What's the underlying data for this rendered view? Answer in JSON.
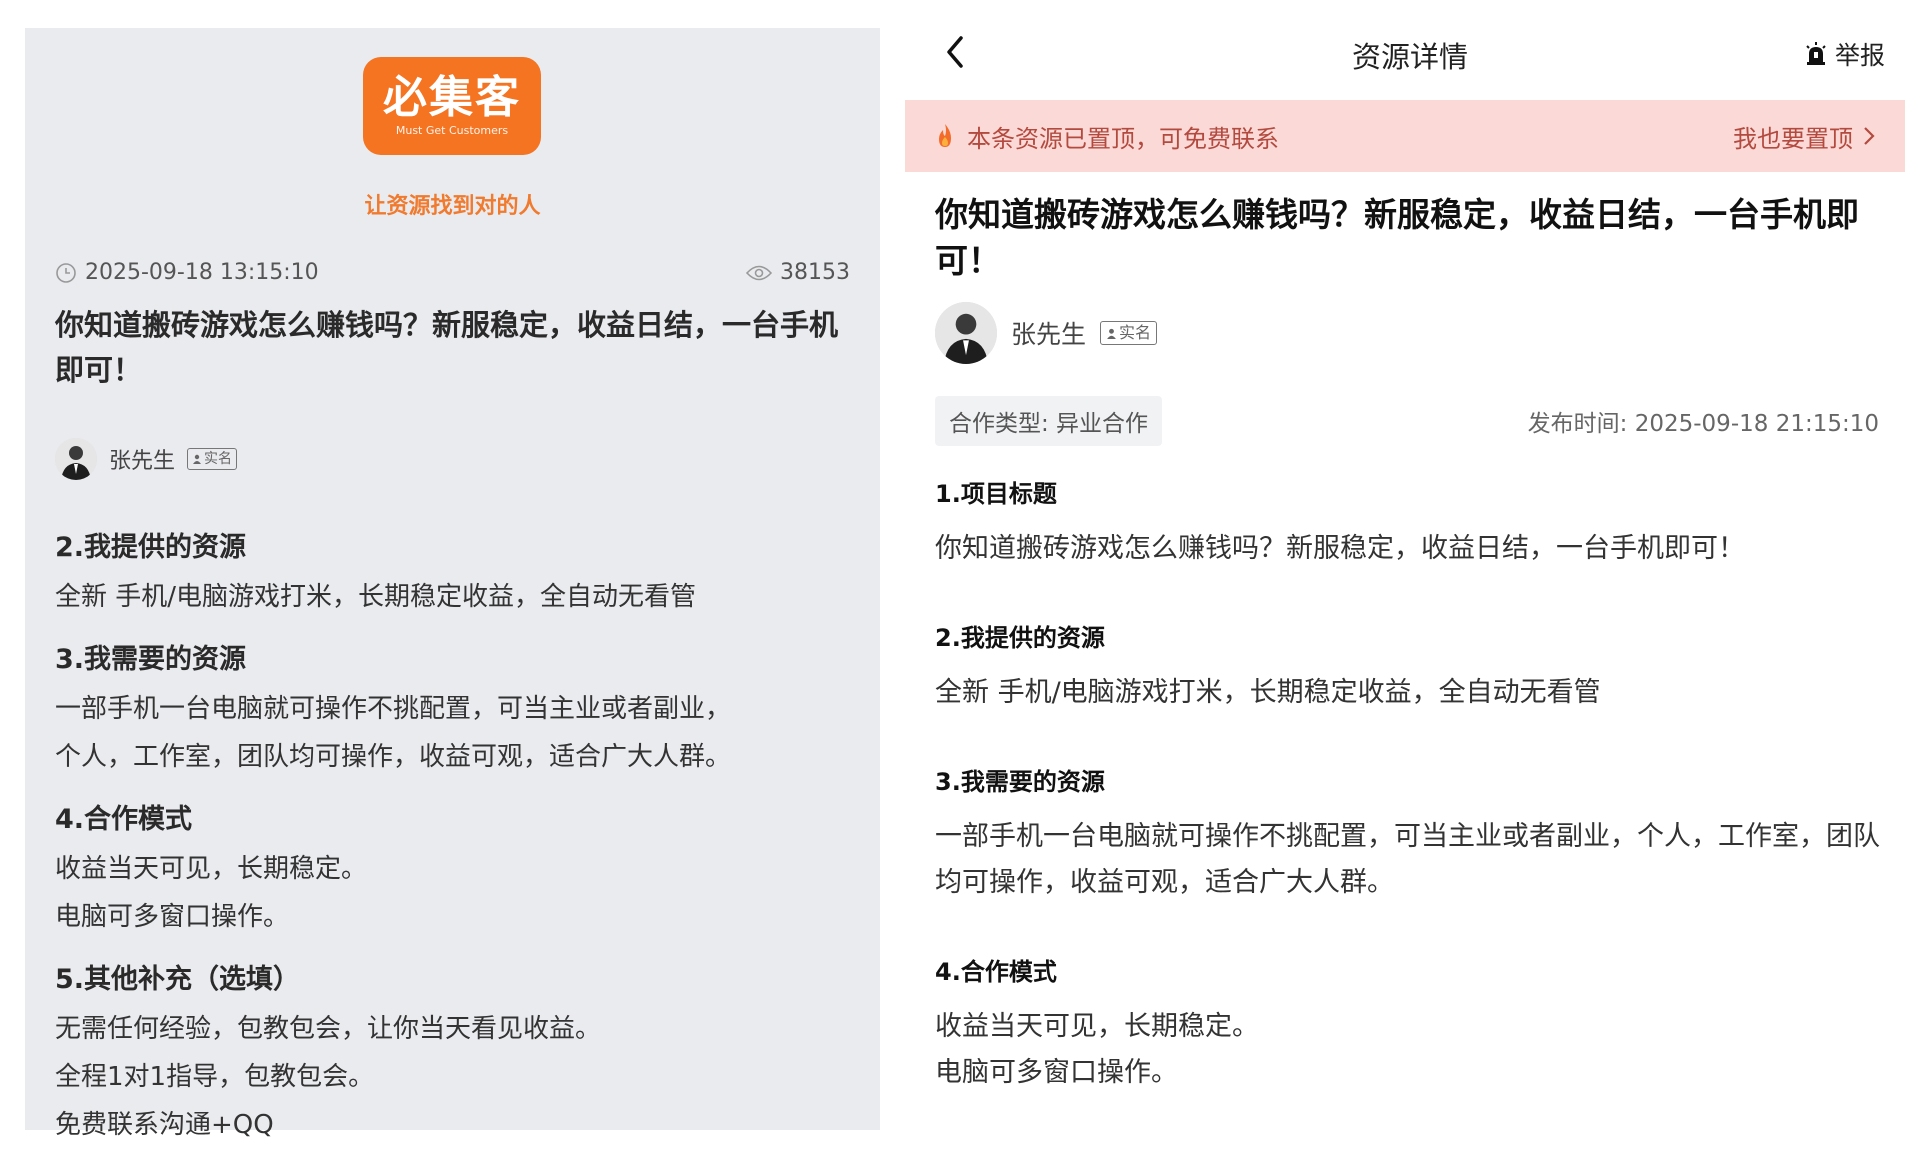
{
  "left": {
    "logo": {
      "name": "必集客",
      "sub": "Must Get Customers"
    },
    "slogan": "让资源找到对的人",
    "timestamp": "2025-09-18 13:15:10",
    "views": "38153",
    "title": "你知道搬砖游戏怎么赚钱吗？新服稳定，收益日结，一台手机即可！",
    "author": {
      "name": "张先生",
      "badge": "实名"
    },
    "sections": [
      {
        "heading": "2.我提供的资源",
        "lines": [
          "全新 手机/电脑游戏打米，长期稳定收益，全自动无看管"
        ]
      },
      {
        "heading": "3.我需要的资源",
        "lines": [
          "一部手机一台电脑就可操作不挑配置，可当主业或者副业，",
          "个人，工作室，团队均可操作，收益可观，适合广大人群。"
        ]
      },
      {
        "heading": "4.合作模式",
        "lines": [
          "收益当天可见，长期稳定。",
          "电脑可多窗口操作。"
        ]
      },
      {
        "heading": "5.其他补充（选填）",
        "lines": [
          "无需任何经验，包教包会，让你当天看见收益。",
          "全程1对1指导，包教包会。",
          "免费联系沟通+QQ"
        ]
      }
    ]
  },
  "right": {
    "nav": {
      "title": "资源详情",
      "report": "举报"
    },
    "banner": {
      "text": "本条资源已置顶，可免费联系",
      "action": "我也要置顶"
    },
    "title": "你知道搬砖游戏怎么赚钱吗？新服稳定，收益日结，一台手机即可！",
    "author": {
      "name": "张先生",
      "badge": "实名"
    },
    "coop_type": "合作类型: 异业合作",
    "publish_time": "发布时间: 2025-09-18 21:15:10",
    "sections": [
      {
        "heading": "1.项目标题",
        "body": "你知道搬砖游戏怎么赚钱吗？新服稳定，收益日结，一台手机即可！"
      },
      {
        "heading": "2.我提供的资源",
        "body": "全新 手机/电脑游戏打米，长期稳定收益，全自动无看管"
      },
      {
        "heading": "3.我需要的资源",
        "body": "一部手机一台电脑就可操作不挑配置，可当主业或者副业，个人，工作室，团队均可操作，收益可观，适合广大人群。"
      },
      {
        "heading": "4.合作模式",
        "body": "收益当天可见，长期稳定。\n电脑可多窗口操作。"
      }
    ]
  },
  "colors": {
    "brand": "#f47421",
    "banner_bg": "#fbd9d6",
    "banner_text": "#b34a3f",
    "left_bg": "#eaebef"
  },
  "icons": [
    "clock-icon",
    "eye-icon",
    "back-chevron-icon",
    "alarm-report-icon",
    "flame-icon",
    "chevron-right-icon",
    "person-badge-icon"
  ]
}
